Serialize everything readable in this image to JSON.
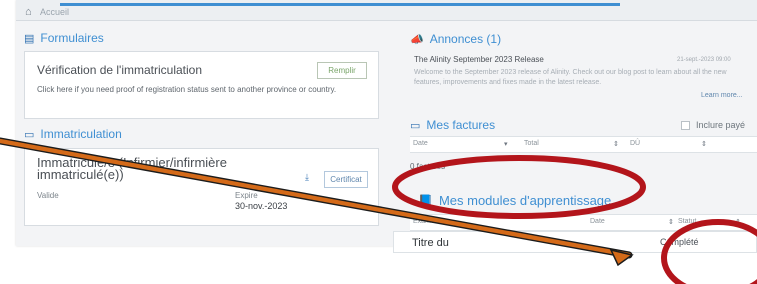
{
  "header": {
    "home_icon": "home-icon",
    "crumb": "Accueil"
  },
  "formulaires": {
    "title": "Formulaires",
    "icon": "form-icon",
    "card_title": "Vérification de l'immatriculation",
    "button": "Remplir",
    "description": "Click here if you need proof of registration status sent to another province or country."
  },
  "immatriculation": {
    "title": "Immatriculation",
    "icon": "card-icon",
    "status_title": "Immatriculé/e (Infirmier/infirmière immatriculé(e))",
    "certificate_button": "Certificat",
    "download_icon": "download-icon",
    "valid_label": "Valide",
    "valid_value": "",
    "expire_label": "Expire",
    "expire_value": "30-nov.-2023"
  },
  "annonces": {
    "title": "Annonces (1)",
    "icon": "megaphone-icon",
    "item_title": "The Alinity September 2023 Release",
    "item_date": "21-sept.-2023 09:00",
    "item_body": "Welcome to the September 2023 release of Alinity. Check out our blog post to learn about all the new features, improvements and fixes made in the latest release.",
    "learn_more": "Learn more..."
  },
  "factures": {
    "title": "Mes factures",
    "icon": "card-icon",
    "include_label": "Inclure payé",
    "filters": [
      "Date",
      "Total",
      "DÛ"
    ],
    "count": "0 factures"
  },
  "modules": {
    "title": "Mes modules d'apprentissage",
    "icon": "book-icon",
    "filters": [
      "Examen",
      "Date",
      "Statut"
    ],
    "row_title": "Titre du",
    "row_date": "",
    "row_status": "Complété"
  },
  "annotations": {
    "arrow_color": "#1c1c1c",
    "arrow_fill": "#d46a19",
    "circle_color": "#b3151b"
  }
}
